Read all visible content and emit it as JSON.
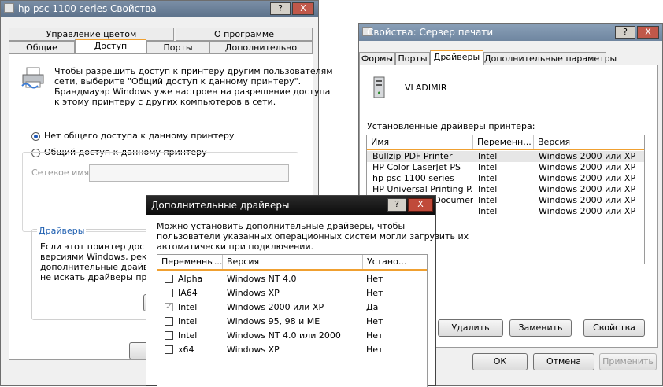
{
  "props_window": {
    "title": "hp psc 1100 series Свойства",
    "help_btn": "?",
    "close_btn": "X",
    "tabs_row1": [
      "Управление цветом",
      "О программе"
    ],
    "tabs_row2": [
      "Общие",
      "Доступ",
      "Порты",
      "Дополнительно"
    ],
    "info_text": [
      "Чтобы разрешить доступ к принтеру другим пользователям",
      "сети, выберите \"Общий доступ к данному принтеру\".",
      "Брандмауэр Windows уже настроен на разрешение доступа",
      "к этому принтеру с других компьютеров в сети."
    ],
    "radio_no_share": "Нет общего доступа к данному принтеру",
    "radio_share": "Общий доступ к данному принтеру",
    "share_name_label": "Сетевое имя:",
    "drivers_group": "Драйверы",
    "drivers_text": [
      "Если этот принтер доступе",
      "версиями Windows, рекоме",
      "дополнительные драйверы",
      "не искать драйверы принт"
    ]
  },
  "server_window": {
    "title": "Свойства: Сервер печати",
    "help_btn": "?",
    "close_btn": "X",
    "tabs": [
      "Формы",
      "Порты",
      "Драйверы",
      "Дополнительные параметры"
    ],
    "server_name": "VLADIMIR",
    "installed_label": "Установленные драйверы принтера:",
    "columns": [
      "Имя",
      "Переменн...",
      "Версия"
    ],
    "drivers": [
      {
        "name": "Bullzip PDF Printer",
        "env": "Intel",
        "version": "Windows 2000 или XP"
      },
      {
        "name": "HP Color LaserJet PS",
        "env": "Intel",
        "version": "Windows 2000 или XP"
      },
      {
        "name": "hp psc 1100 series",
        "env": "Intel",
        "version": "Windows 2000 или XP"
      },
      {
        "name": "HP Universal Printing P...",
        "env": "Intel",
        "version": "Windows 2000 или XP"
      },
      {
        "name": "Microsoft XPS Documen...",
        "env": "Intel",
        "version": "Windows 2000 или XP"
      },
      {
        "name": "",
        "env": "Intel",
        "version": "Windows 2000 или XP"
      }
    ],
    "btn_remove": "Удалить",
    "btn_replace": "Заменить",
    "btn_props": "Свойства",
    "btn_ok": "ОК",
    "btn_cancel": "Отмена",
    "btn_apply": "Применить"
  },
  "extra_dialog": {
    "title": "Дополнительные драйверы",
    "help_btn": "?",
    "close_btn": "X",
    "description": [
      "Можно установить дополнительные драйверы, чтобы",
      "пользователи указанных операционных систем могли загрузить их",
      "автоматически при подключении."
    ],
    "columns": [
      "Переменны...",
      "Версия",
      "Устано..."
    ],
    "rows": [
      {
        "env": "Alpha",
        "version": "Windows NT 4.0",
        "installed": "Нет",
        "checked": false
      },
      {
        "env": "IA64",
        "version": "Windows XP",
        "installed": "Нет",
        "checked": false
      },
      {
        "env": "Intel",
        "version": "Windows 2000 или XP",
        "installed": "Да",
        "checked": true
      },
      {
        "env": "Intel",
        "version": "Windows 95, 98 и ME",
        "installed": "Нет",
        "checked": false
      },
      {
        "env": "Intel",
        "version": "Windows NT 4.0 или 2000",
        "installed": "Нет",
        "checked": false
      },
      {
        "env": "x64",
        "version": "Windows XP",
        "installed": "Нет",
        "checked": false
      }
    ]
  }
}
